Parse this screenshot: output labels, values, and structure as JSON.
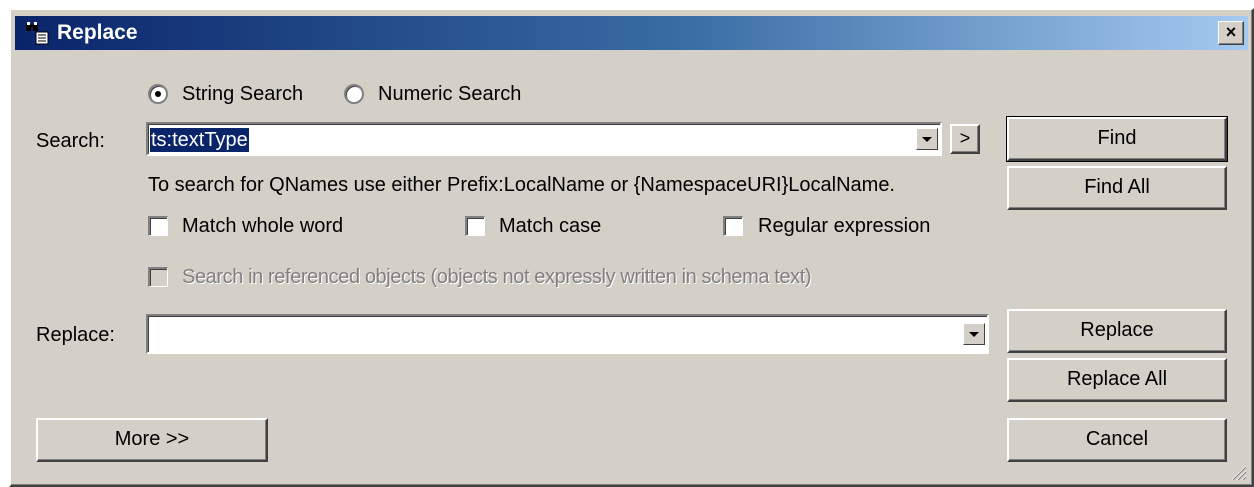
{
  "window": {
    "title": "Replace",
    "close_glyph": "×"
  },
  "search_mode": {
    "string_label": "String Search",
    "numeric_label": "Numeric Search",
    "selected": "string"
  },
  "search": {
    "label": "Search:",
    "value": "ts:textType",
    "expand_glyph": ">",
    "hint": "To search for QNames use either Prefix:LocalName or {NamespaceURI}LocalName."
  },
  "options": {
    "match_whole_word": "Match whole word",
    "match_case": "Match case",
    "regular_expression": "Regular expression",
    "referenced_objects": "Search in referenced objects (objects not expressly written in schema text)"
  },
  "replace": {
    "label": "Replace:",
    "value": ""
  },
  "buttons": {
    "find": "Find",
    "find_all": "Find All",
    "replace": "Replace",
    "replace_all": "Replace All",
    "more": "More >>",
    "cancel": "Cancel"
  }
}
